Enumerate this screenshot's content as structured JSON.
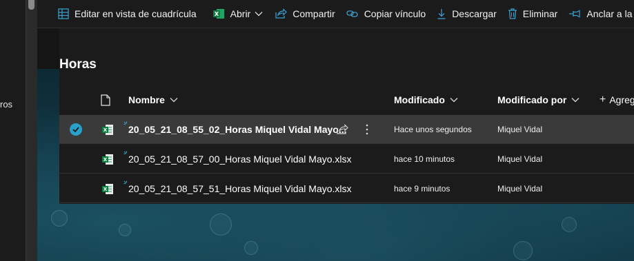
{
  "sidebar": {
    "partial_label": "ros"
  },
  "command_bar": {
    "items": [
      {
        "label": "Editar en vista de cuadrícula",
        "icon": "grid-icon"
      },
      {
        "label": "Abrir",
        "icon": "excel-icon"
      },
      {
        "label": "Compartir",
        "icon": "share-icon"
      },
      {
        "label": "Copiar vínculo",
        "icon": "link-icon"
      },
      {
        "label": "Descargar",
        "icon": "download-icon"
      },
      {
        "label": "Eliminar",
        "icon": "trash-icon"
      },
      {
        "label": "Anclar a la pa",
        "icon": "pin-icon"
      }
    ]
  },
  "library": {
    "title": "Horas"
  },
  "columns": {
    "name": "Nombre",
    "modified": "Modificado",
    "modified_by": "Modificado por",
    "add_column": "Agreg"
  },
  "files": [
    {
      "name": "20_05_21_08_55_02_Horas Miquel Vidal Mayo...",
      "modified": "Hace unos segundos",
      "modified_by": "Miquel Vidal",
      "selected": true
    },
    {
      "name": "20_05_21_08_57_00_Horas Miquel Vidal Mayo.xlsx",
      "modified": "hace 10 minutos",
      "modified_by": "Miquel Vidal",
      "selected": false
    },
    {
      "name": "20_05_21_08_57_51_Horas Miquel Vidal Mayo.xlsx",
      "modified": "hace 9 minutos",
      "modified_by": "Miquel Vidal",
      "selected": false
    }
  ],
  "colors": {
    "accent": "#2aa0c9",
    "excel": "#1e7145",
    "selected_row": "#3a3a3a"
  }
}
